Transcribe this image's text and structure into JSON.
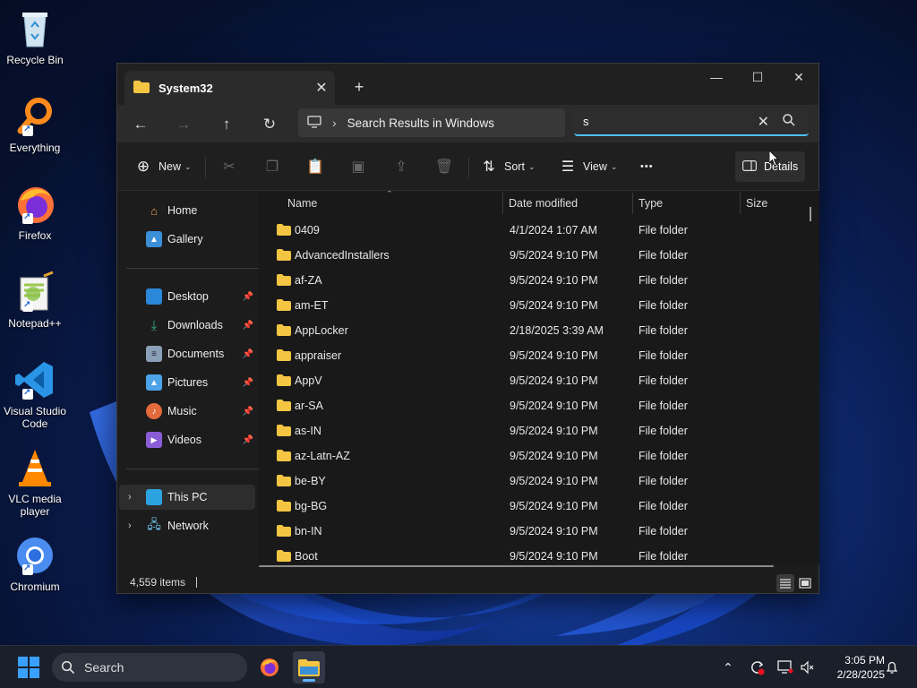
{
  "desktop": {
    "icons": [
      {
        "label": "Recycle Bin"
      },
      {
        "label": "Everything"
      },
      {
        "label": "Firefox"
      },
      {
        "label": "Notepad++"
      },
      {
        "label": "Visual Studio Code"
      },
      {
        "label": "VLC media player"
      },
      {
        "label": "Chromium"
      }
    ]
  },
  "window": {
    "tab_title": "System32",
    "tab_close": "✕",
    "new_tab": "+",
    "controls": {
      "minimize": "—",
      "maximize": "☐",
      "close": "✕"
    },
    "nav": {
      "back": "←",
      "forward": "→",
      "up": "↑",
      "refresh": "↻"
    },
    "address": {
      "separator": "›",
      "path": "Search Results in Windows"
    },
    "search": {
      "value": "s",
      "clear": "✕"
    },
    "toolbar": {
      "new_label": "New",
      "sort_label": "Sort",
      "view_label": "View",
      "more_label": "•••",
      "details_label": "Details"
    },
    "navpane": {
      "home": "Home",
      "gallery": "Gallery",
      "desktop": "Desktop",
      "downloads": "Downloads",
      "documents": "Documents",
      "pictures": "Pictures",
      "music": "Music",
      "videos": "Videos",
      "this_pc": "This PC",
      "network": "Network",
      "pin": "📌",
      "chevron": "›"
    },
    "columns": {
      "name": "Name",
      "date": "Date modified",
      "type": "Type",
      "size": "Size"
    },
    "rows": [
      {
        "name": "0409",
        "date": "4/1/2024 1:07 AM",
        "type": "File folder"
      },
      {
        "name": "AdvancedInstallers",
        "date": "9/5/2024 9:10 PM",
        "type": "File folder"
      },
      {
        "name": "af-ZA",
        "date": "9/5/2024 9:10 PM",
        "type": "File folder"
      },
      {
        "name": "am-ET",
        "date": "9/5/2024 9:10 PM",
        "type": "File folder"
      },
      {
        "name": "AppLocker",
        "date": "2/18/2025 3:39 AM",
        "type": "File folder"
      },
      {
        "name": "appraiser",
        "date": "9/5/2024 9:10 PM",
        "type": "File folder"
      },
      {
        "name": "AppV",
        "date": "9/5/2024 9:10 PM",
        "type": "File folder"
      },
      {
        "name": "ar-SA",
        "date": "9/5/2024 9:10 PM",
        "type": "File folder"
      },
      {
        "name": "as-IN",
        "date": "9/5/2024 9:10 PM",
        "type": "File folder"
      },
      {
        "name": "az-Latn-AZ",
        "date": "9/5/2024 9:10 PM",
        "type": "File folder"
      },
      {
        "name": "be-BY",
        "date": "9/5/2024 9:10 PM",
        "type": "File folder"
      },
      {
        "name": "bg-BG",
        "date": "9/5/2024 9:10 PM",
        "type": "File folder"
      },
      {
        "name": "bn-IN",
        "date": "9/5/2024 9:10 PM",
        "type": "File folder"
      },
      {
        "name": "Boot",
        "date": "9/5/2024 9:10 PM",
        "type": "File folder"
      }
    ],
    "status": {
      "items": "4,559 items"
    }
  },
  "taskbar": {
    "search_label": "Search",
    "time": "3:05 PM",
    "date": "2/28/2025"
  },
  "colors": {
    "accent": "#4cc2ff",
    "folder": "#f4c542"
  }
}
